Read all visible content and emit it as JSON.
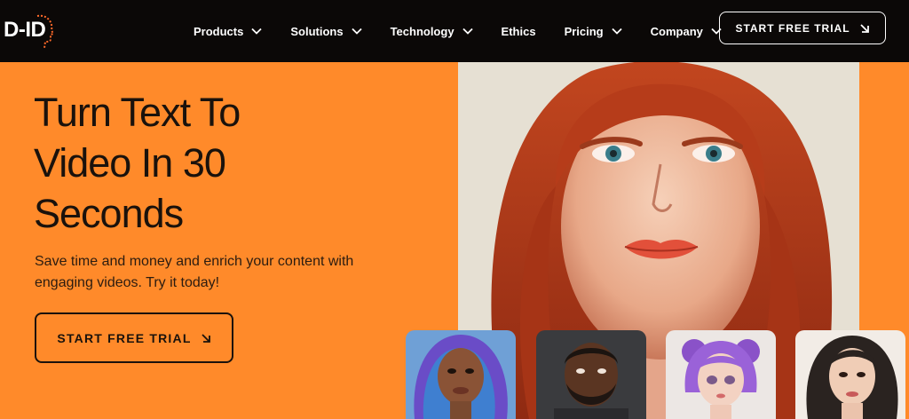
{
  "brand": {
    "logo_text": "D-ID"
  },
  "nav": {
    "items": [
      {
        "label": "Products",
        "has_dropdown": true
      },
      {
        "label": "Solutions",
        "has_dropdown": true
      },
      {
        "label": "Technology",
        "has_dropdown": true
      },
      {
        "label": "Ethics",
        "has_dropdown": false
      },
      {
        "label": "Pricing",
        "has_dropdown": true
      },
      {
        "label": "Company",
        "has_dropdown": true
      }
    ],
    "cta_label": "START FREE TRIAL"
  },
  "hero": {
    "title_lines": [
      "Turn Text To",
      "Video In 30",
      "Seconds"
    ],
    "subtitle_lines": [
      "Save time and money and enrich your content with",
      "engaging videos. Try it today!"
    ],
    "cta_label": "START FREE TRIAL"
  },
  "colors": {
    "header_bg": "#0b0807",
    "hero_bg": "#ff8a2a",
    "text_dark": "#1a120c",
    "logo_accent": "#ff6a2a"
  },
  "icons": {
    "nav_dropdown": "chevron-down-icon",
    "cta_arrow": "arrow-down-right-icon",
    "logo_mark": "head-profile-icon"
  },
  "images": {
    "hero": "red-haired-woman-portrait",
    "thumbnails": [
      "blue-purple-haired-woman-avatar",
      "bearded-man-avatar",
      "purple-haired-anime-girl-avatar",
      "dark-haired-woman-avatar"
    ]
  }
}
